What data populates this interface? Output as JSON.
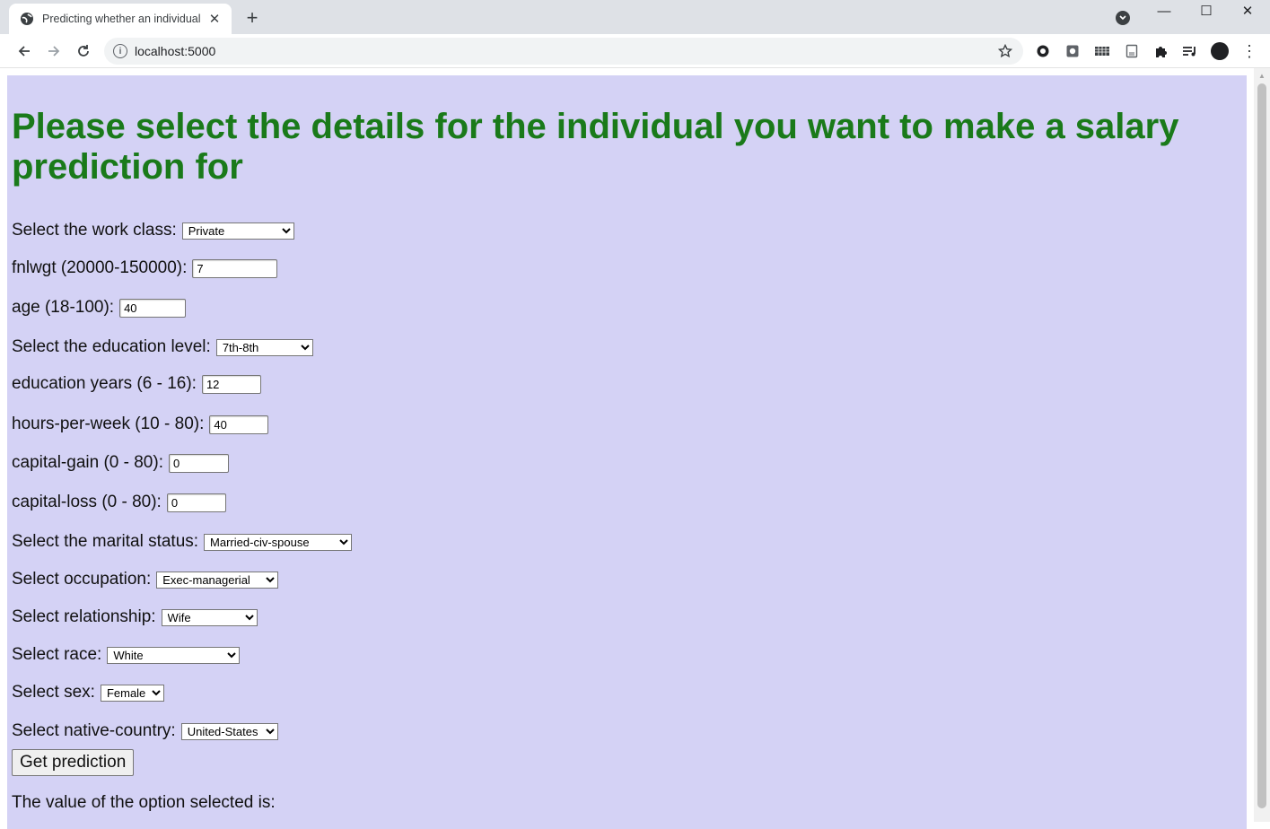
{
  "browser": {
    "tab_title": "Predicting whether an individual",
    "url": "localhost:5000",
    "icons": {
      "tab": "globe-icon",
      "close": "close-icon",
      "new_tab": "plus-icon",
      "back": "back-arrow-icon",
      "forward": "forward-arrow-icon",
      "reload": "reload-icon",
      "info": "info-icon",
      "bookmark": "star-icon",
      "extensions": [
        "circle-extension-icon",
        "gear-extension-icon",
        "grid-extension-icon",
        "page-extension-icon",
        "puzzle-icon",
        "media-icon",
        "profile-avatar-icon",
        "kebab-menu-icon"
      ]
    },
    "glyphs": {
      "close": "✕",
      "new_tab": "+",
      "minimize": "—",
      "maximize": "☐",
      "win_close": "✕",
      "info": "i",
      "menu": "⋮"
    }
  },
  "page": {
    "background": "#d4d2f5",
    "heading_color": "#1a7a1a",
    "heading": "Please select the details for the individual you want to make a salary prediction for",
    "fields": {
      "workclass": {
        "label": "Select the work class:",
        "value": "Private"
      },
      "fnlwgt": {
        "label": "fnlwgt (20000-150000):",
        "value": "7"
      },
      "age": {
        "label": "age (18-100):",
        "value": "40"
      },
      "education": {
        "label": "Select the education level:",
        "value": "7th-8th"
      },
      "education_years": {
        "label": "education years (6 - 16):",
        "value": "12"
      },
      "hours": {
        "label": "hours-per-week (10 - 80):",
        "value": "40"
      },
      "capital_gain": {
        "label": "capital-gain (0 - 80):",
        "value": "0"
      },
      "capital_loss": {
        "label": "capital-loss (0 - 80):",
        "value": "0"
      },
      "marital": {
        "label": "Select the marital status:",
        "value": "Married-civ-spouse"
      },
      "occupation": {
        "label": "Select occupation:",
        "value": "Exec-managerial"
      },
      "relationship": {
        "label": "Select relationship:",
        "value": "Wife"
      },
      "race": {
        "label": "Select race:",
        "value": "White"
      },
      "sex": {
        "label": "Select sex:",
        "value": "Female"
      },
      "country": {
        "label": "Select native-country:",
        "value": "United-States"
      }
    },
    "submit_label": "Get prediction",
    "result_text": "The value of the option selected is:"
  }
}
